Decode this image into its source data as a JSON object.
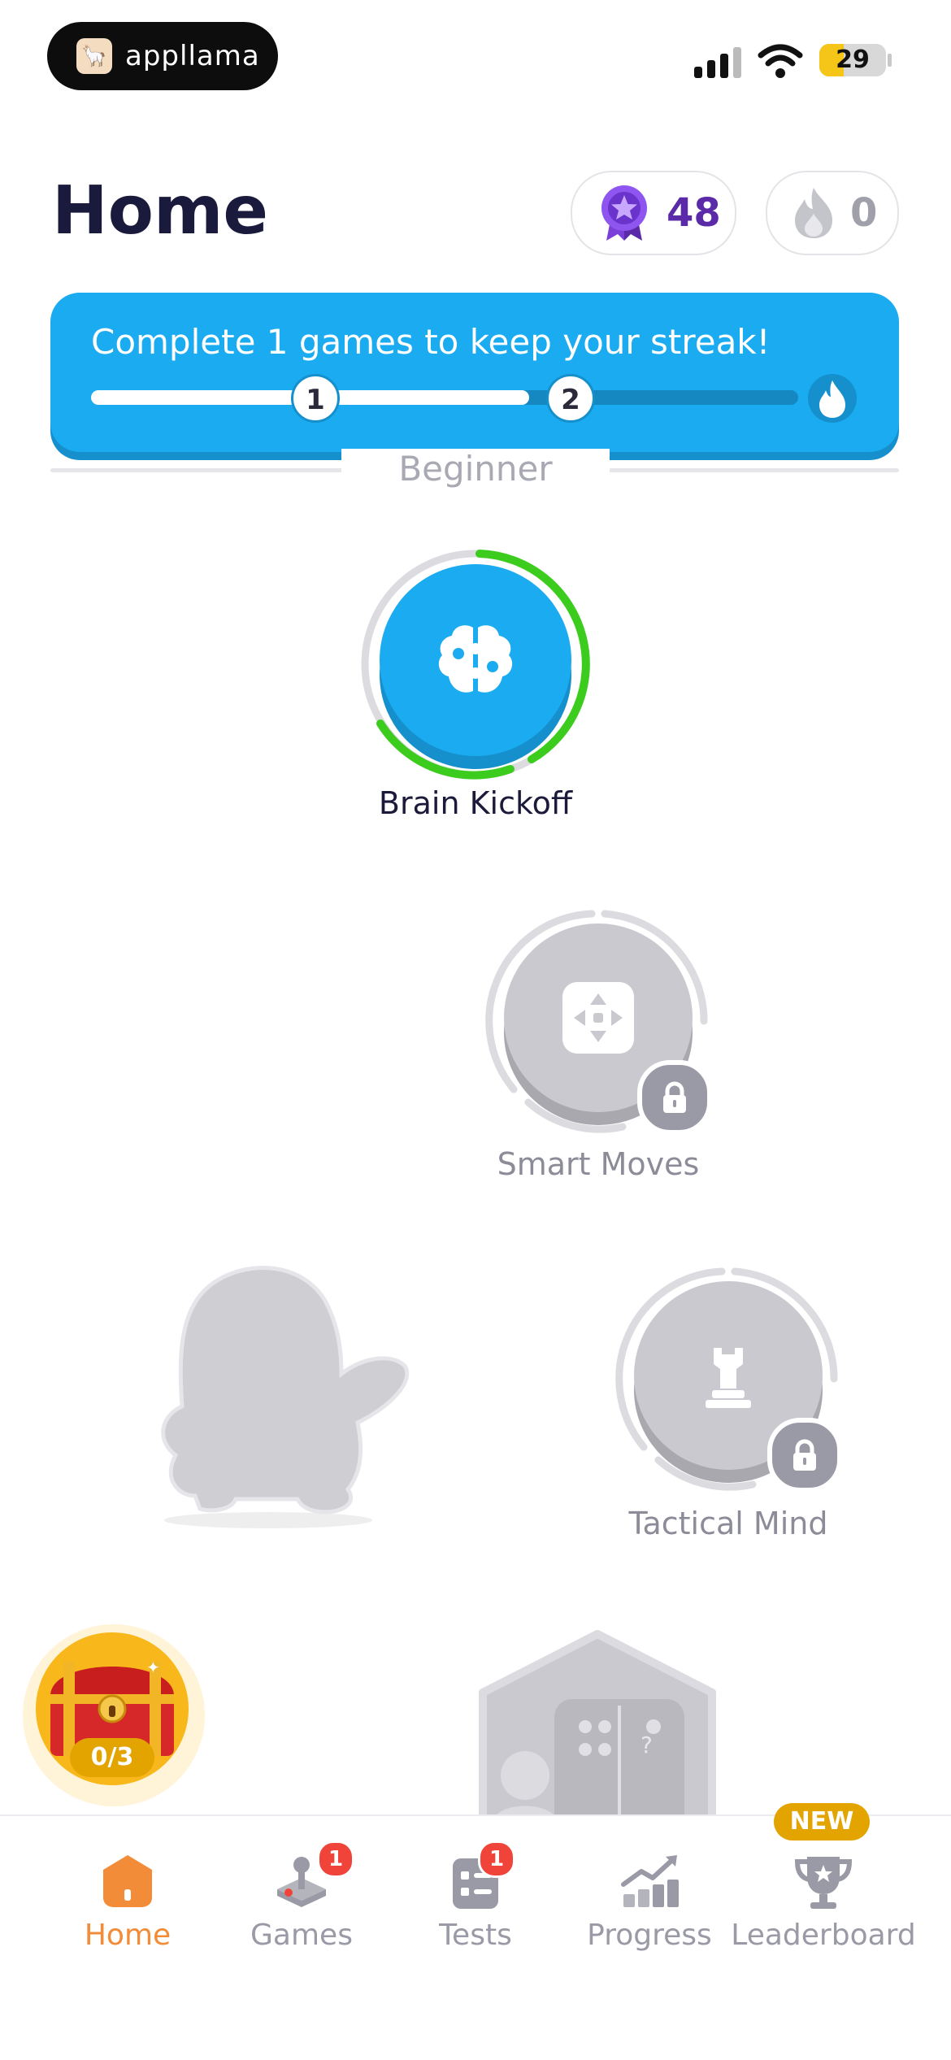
{
  "status_bar": {
    "app_name": "appllama",
    "battery": "29"
  },
  "header": {
    "title": "Home",
    "xp_value": "48",
    "streak_value": "0"
  },
  "streak_banner": {
    "message": "Complete 1 games to keep your streak!",
    "steps": [
      "1",
      "2"
    ],
    "progress": 0.62
  },
  "section": {
    "label": "Beginner"
  },
  "nodes": [
    {
      "label": "Brain Kickoff",
      "state": "active",
      "icon": "brain-puzzle-icon",
      "progress": 0.6
    },
    {
      "label": "Smart Moves",
      "state": "locked",
      "icon": "move-arrows-icon"
    },
    {
      "label": "Tactical Mind",
      "state": "locked",
      "icon": "chess-rook-icon"
    },
    {
      "label": "",
      "state": "locked",
      "icon": "puzzle-test-icon"
    }
  ],
  "chest": {
    "progress": "0/3"
  },
  "tabbar": {
    "items": [
      {
        "label": "Home",
        "icon": "home-icon",
        "active": true
      },
      {
        "label": "Games",
        "icon": "joystick-icon",
        "badge": "1"
      },
      {
        "label": "Tests",
        "icon": "clipboard-icon",
        "badge": "1"
      },
      {
        "label": "Progress",
        "icon": "chart-up-icon"
      },
      {
        "label": "Leaderboard",
        "icon": "trophy-icon",
        "tag": "NEW"
      }
    ]
  },
  "colors": {
    "accent": "#1aabf0",
    "active_tab": "#f28c38",
    "progress_green": "#3ccc1e",
    "locked_gray": "#c9c9cf"
  }
}
